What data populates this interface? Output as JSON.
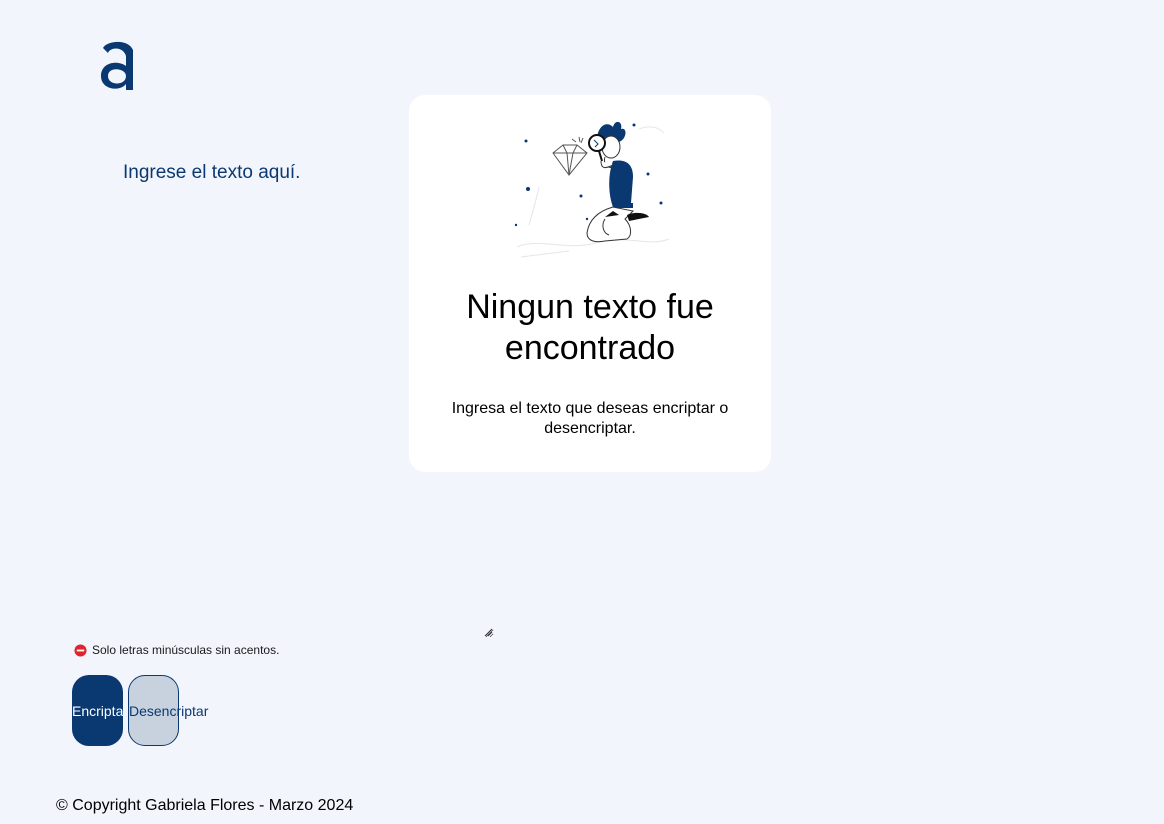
{
  "brand": {
    "logo_letter": "a",
    "logo_icon": "alura-logo-icon",
    "accent_color": "#0a3871"
  },
  "input": {
    "placeholder": "Ingrese el texto aquí.",
    "value": ""
  },
  "output_card": {
    "illustration": "person-with-magnifying-glass-illustration",
    "title": "Ningun texto fue encontrado",
    "description": "Ingresa el texto que deseas encriptar o desencriptar."
  },
  "hint": {
    "icon": "no-entry-icon",
    "text": "Solo letras minúsculas sin acentos."
  },
  "buttons": {
    "encrypt_label": "Encriptar",
    "decrypt_label": "Desencriptar"
  },
  "footer": {
    "text": "© Copyright Gabriela Flores - Marzo 2024"
  }
}
